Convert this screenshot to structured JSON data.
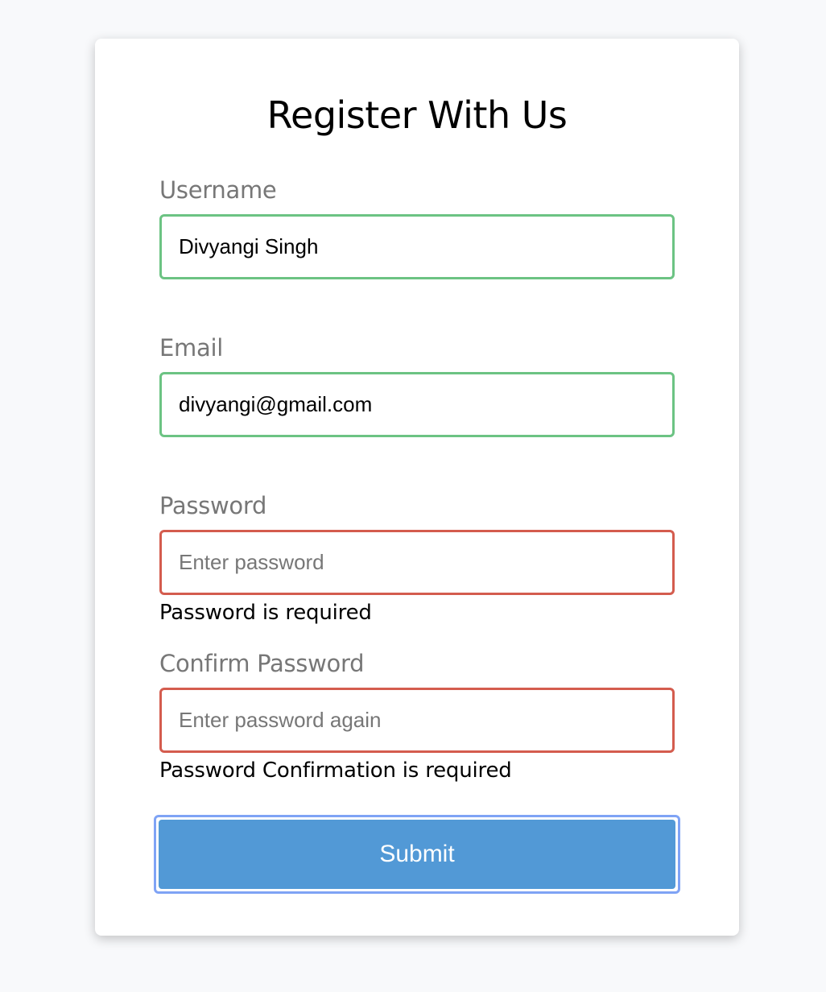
{
  "form": {
    "title": "Register With Us",
    "fields": [
      {
        "label": "Username",
        "value": "Divyangi Singh",
        "placeholder": "",
        "state": "success",
        "error": ""
      },
      {
        "label": "Email",
        "value": "divyangi@gmail.com",
        "placeholder": "",
        "state": "success",
        "error": ""
      },
      {
        "label": "Password",
        "value": "",
        "placeholder": "Enter password",
        "state": "error",
        "error": "Password is required"
      },
      {
        "label": "Confirm Password",
        "value": "",
        "placeholder": "Enter password again",
        "state": "error",
        "error": "Password Confirmation is required"
      }
    ],
    "submit_label": "Submit"
  },
  "colors": {
    "background": "#f8f9fb",
    "success_border": "#6cc383",
    "error_border": "#d45c4e",
    "button": "#5299d6",
    "button_focus_ring": "#7fa3f5",
    "label": "#777777"
  }
}
